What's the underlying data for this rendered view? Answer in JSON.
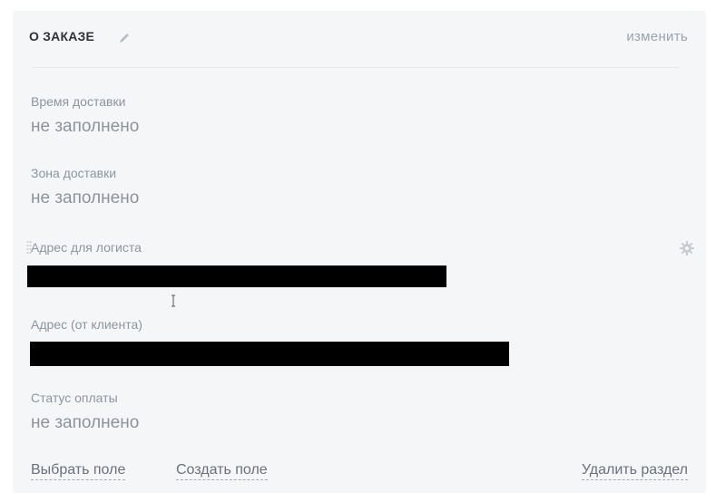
{
  "header": {
    "title": "О ЗАКАЗЕ",
    "edit_link": "изменить"
  },
  "fields": [
    {
      "label": "Время доставки",
      "value": "не заполнено"
    },
    {
      "label": "Зона доставки",
      "value": "не заполнено"
    },
    {
      "label": "Адрес для логиста",
      "value": ""
    },
    {
      "label": "Адрес (от клиента)",
      "value": ""
    },
    {
      "label": "Статус оплаты",
      "value": "не заполнено"
    }
  ],
  "footer": {
    "choose_field": "Выбрать поле",
    "create_field": "Создать поле",
    "delete_section": "Удалить раздел"
  },
  "icons": {
    "pencil": "pencil-icon",
    "gear": "gear-icon",
    "drag": "drag-handle-icon"
  },
  "colors": {
    "card_bg": "#f5f6f8",
    "label": "#8e959e",
    "value": "#8d939b",
    "link": "#6b7079"
  }
}
